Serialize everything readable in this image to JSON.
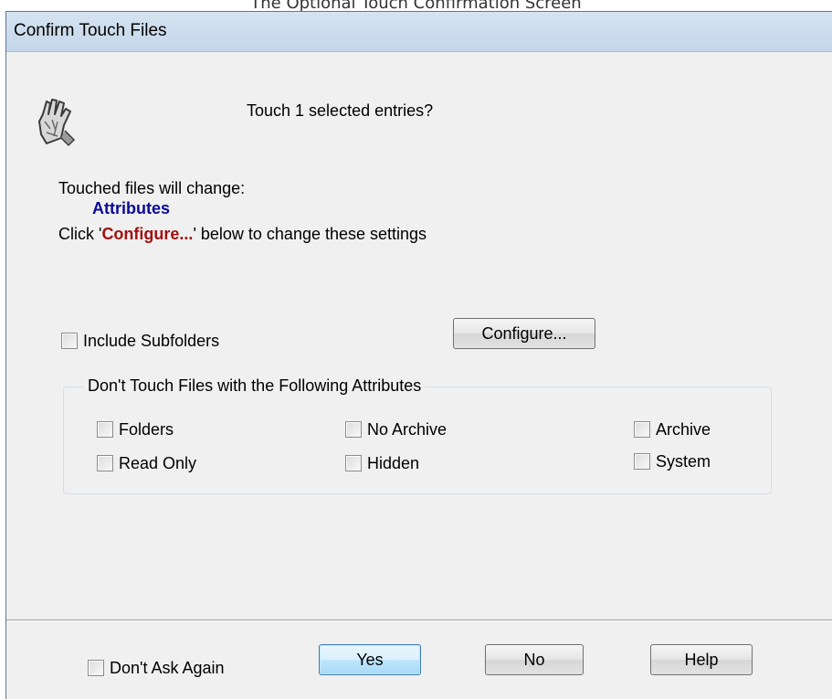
{
  "caption": "The Optional Touch Confirmation Screen",
  "dialog": {
    "title": "Confirm Touch Files",
    "icon": "touch-hand-icon",
    "question": "Touch 1 selected entries?",
    "touched_label": "Touched files will change:",
    "attributes_value": "Attributes",
    "configure_prefix": "Click '",
    "configure_word": "Configure...",
    "configure_suffix": "' below to change these settings"
  },
  "include_subfolders": {
    "label": "Include Subfolders",
    "checked": false
  },
  "configure_button": "Configure...",
  "exclude_group": {
    "legend": "Don't Touch Files with the Following Attributes",
    "options": [
      {
        "label": "Folders",
        "checked": false
      },
      {
        "label": "No Archive",
        "checked": false
      },
      {
        "label": "Archive",
        "checked": false
      },
      {
        "label": "Read Only",
        "checked": false
      },
      {
        "label": "Hidden",
        "checked": false
      },
      {
        "label": "System",
        "checked": false
      }
    ]
  },
  "footer": {
    "dont_ask_again": "Don't Ask Again",
    "yes": "Yes",
    "no": "No",
    "help": "Help"
  },
  "colors": {
    "attributes_text": "#0a0a96",
    "configure_text": "#a01010",
    "default_button": "#bee6fd",
    "dialog_bg": "#f0f0f0"
  }
}
